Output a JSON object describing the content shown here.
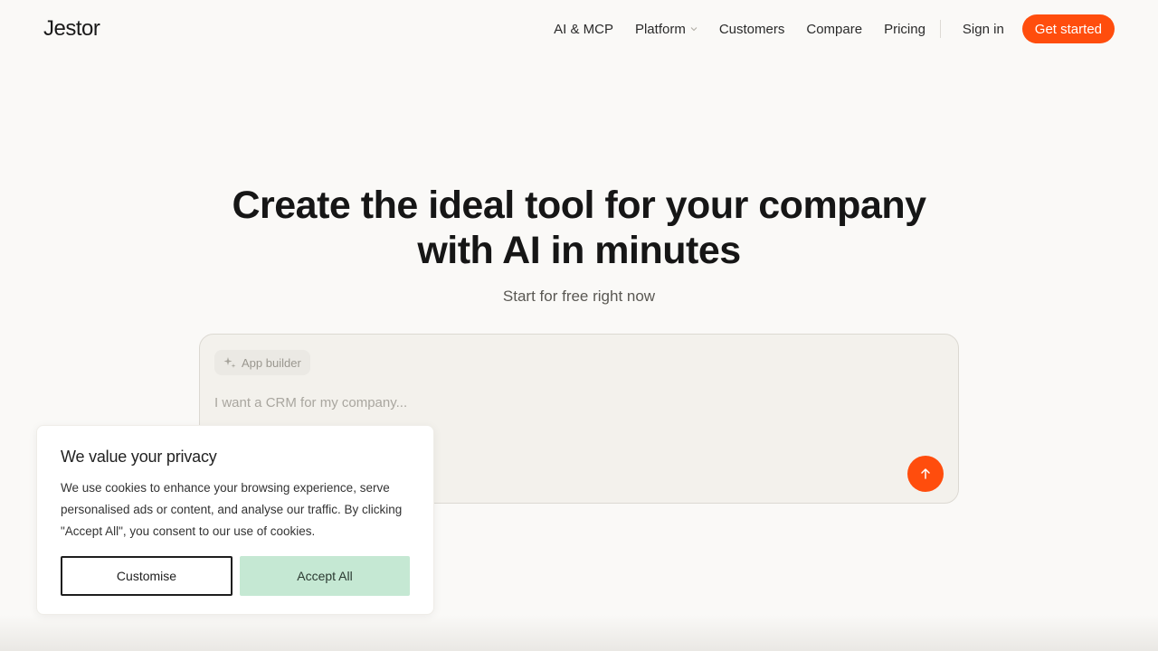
{
  "brand": {
    "logo": "Jestor",
    "accent": "#ff4d0d"
  },
  "nav": {
    "items": [
      {
        "label": "AI & MCP"
      },
      {
        "label": "Platform",
        "has_dropdown": true
      },
      {
        "label": "Customers"
      },
      {
        "label": "Compare"
      },
      {
        "label": "Pricing"
      }
    ],
    "sign_in": "Sign in",
    "get_started": "Get started"
  },
  "hero": {
    "title_line1": "Create the ideal tool for your company",
    "title_line2": "with AI in minutes",
    "subtitle": "Start for free right now"
  },
  "prompt": {
    "chip_label": "App builder",
    "chip_icon": "sparkle-icon",
    "placeholder": "I want a CRM for my company...",
    "send_icon": "arrow-up-icon"
  },
  "cookie": {
    "title": "We value your privacy",
    "text": "We use cookies to enhance your browsing experience, serve personalised ads or content, and analyse our traffic. By clicking \"Accept All\", you consent to our use of cookies.",
    "customise_label": "Customise",
    "accept_label": "Accept All",
    "accept_color": "#c5e8d3"
  }
}
